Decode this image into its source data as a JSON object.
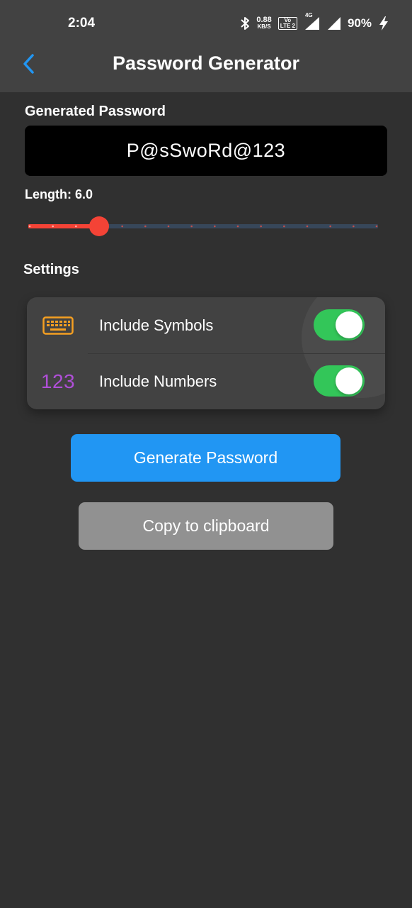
{
  "status_bar": {
    "time": "2:04",
    "net_speed": "0.88",
    "net_speed_unit": "KB/S",
    "volte_top": "Vo",
    "volte_bottom": "LTE 2",
    "network_type": "4G",
    "battery": "90%",
    "icons": [
      "bluetooth-icon",
      "signal-icon",
      "battery-charging-icon"
    ]
  },
  "header": {
    "title": "Password Generator",
    "back_icon": "chevron-left-icon",
    "accent": "#2196f3"
  },
  "generated": {
    "label": "Generated Password",
    "value": "P@sSwoRd@123"
  },
  "length": {
    "label": "Length: 6.0",
    "value": 6,
    "min": 3,
    "max": 18,
    "active_color": "#f44336",
    "track_color": "#37475a"
  },
  "settings": {
    "label": "Settings",
    "items": [
      {
        "label": "Include Symbols",
        "icon": "keyboard-icon",
        "icon_color": "#f59f21",
        "enabled": true
      },
      {
        "label": "Include Numbers",
        "icon": "numbers-icon",
        "icon_text": "123",
        "icon_color": "#b04fd8",
        "enabled": true
      }
    ],
    "toggle_on_color": "#33c659"
  },
  "buttons": {
    "generate": "Generate Password",
    "copy": "Copy to clipboard"
  }
}
